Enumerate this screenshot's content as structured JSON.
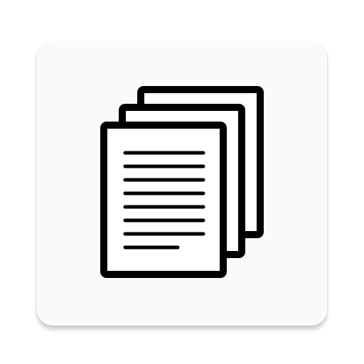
{
  "app_icon": {
    "icon_name": "documents-stack-icon",
    "colors": {
      "tile_background": "#fafafa",
      "paper_fill": "#ffffff",
      "ink": "#000000"
    }
  }
}
